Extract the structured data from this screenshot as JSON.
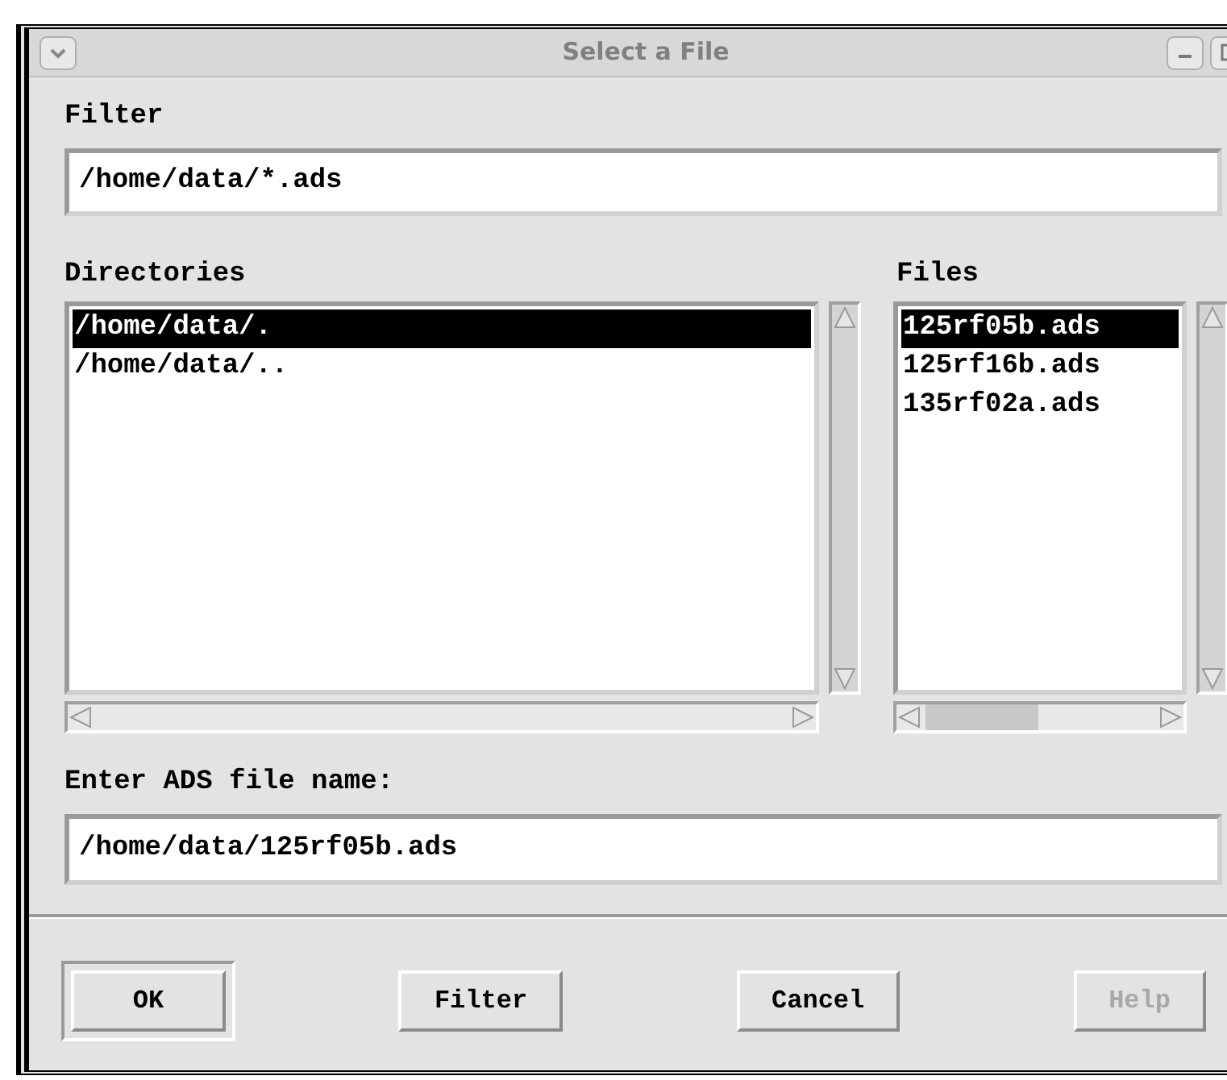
{
  "window": {
    "title": "Select a File"
  },
  "filter": {
    "label": "Filter",
    "value": "/home/data/*.ads"
  },
  "directories": {
    "label": "Directories",
    "items": [
      {
        "name": "/home/data/.",
        "selected": true
      },
      {
        "name": "/home/data/..",
        "selected": false
      }
    ]
  },
  "files": {
    "label": "Files",
    "items": [
      {
        "name": "125rf05b.ads",
        "selected": true
      },
      {
        "name": "125rf16b.ads",
        "selected": false
      },
      {
        "name": "135rf02a.ads",
        "selected": false
      }
    ]
  },
  "selection": {
    "label": "Enter ADS file name:",
    "value": "/home/data/125rf05b.ads"
  },
  "buttons": [
    {
      "label": "OK",
      "default": true,
      "disabled": false
    },
    {
      "label": "Filter",
      "default": false,
      "disabled": false
    },
    {
      "label": "Cancel",
      "default": false,
      "disabled": false
    },
    {
      "label": "Help",
      "default": false,
      "disabled": true
    }
  ]
}
